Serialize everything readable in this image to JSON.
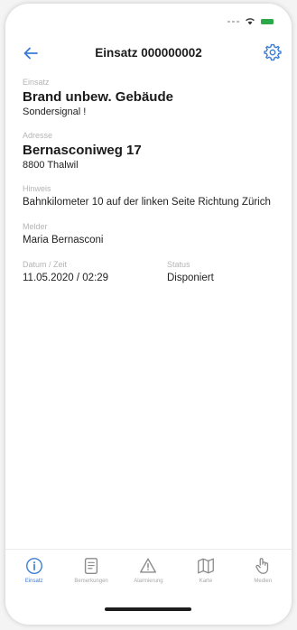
{
  "colors": {
    "accent": "#3a7bd5",
    "battery": "#2ca84a",
    "label": "#b4b4b4"
  },
  "nav": {
    "title": "Einsatz 000000002",
    "back_icon": "arrow-left-icon",
    "settings_icon": "gear-icon"
  },
  "einsatz": {
    "label": "Einsatz",
    "title": "Brand unbew. Gebäude",
    "subtitle": "Sondersignal !"
  },
  "adresse": {
    "label": "Adresse",
    "street": "Bernasconiweg 17",
    "city": "8800 Thalwil"
  },
  "hinweis": {
    "label": "Hinweis",
    "text": "Bahnkilometer 10 auf der linken Seite Richtung Zürich"
  },
  "melder": {
    "label": "Melder",
    "name": "Maria Bernasconi"
  },
  "datum": {
    "label": "Datum / Zeit",
    "value": "11.05.2020 / 02:29"
  },
  "status": {
    "label": "Status",
    "value": "Disponiert"
  },
  "tabs": [
    {
      "label": "Einsatz",
      "icon": "info-icon",
      "active": true
    },
    {
      "label": "Bemerkungen",
      "icon": "document-icon",
      "active": false
    },
    {
      "label": "Alarmierung",
      "icon": "warning-icon",
      "active": false
    },
    {
      "label": "Karte",
      "icon": "map-icon",
      "active": false
    },
    {
      "label": "Medien",
      "icon": "hand-pointer-icon",
      "active": false
    }
  ]
}
